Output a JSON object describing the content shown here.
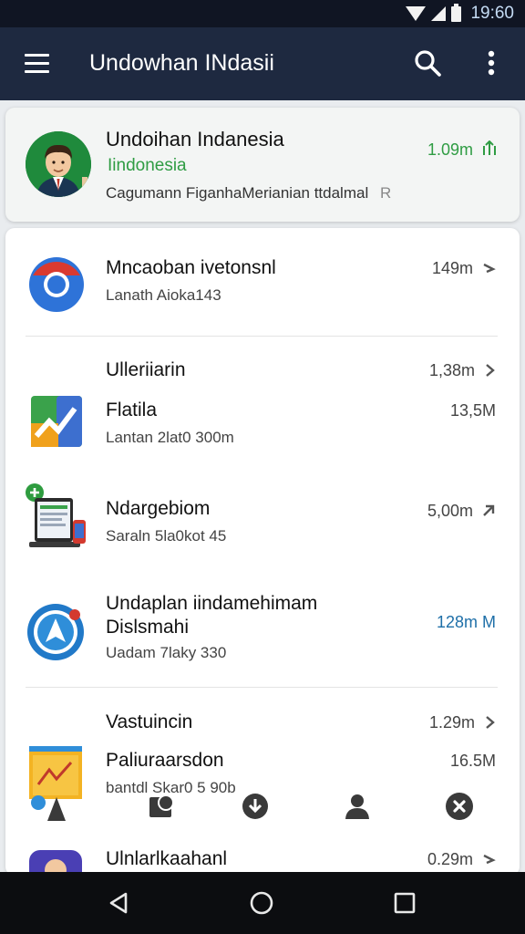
{
  "status_bar": {
    "time": "19:60"
  },
  "app_bar": {
    "title": "Undowhan INdasii"
  },
  "featured": {
    "title": "Undoihan Indanesia",
    "subtitle": "Iindonesia",
    "description": "Cagumann FiganhaMerianian ttdalmal",
    "description_tail": "R",
    "size": "1.09m"
  },
  "items": [
    {
      "title": "Mncaoban ivetonsnl",
      "subtitle": "Lanath Aioka143",
      "size": "149m"
    },
    {
      "title": "Ulleriiarin",
      "size": "1,38m"
    },
    {
      "title": "Flatila",
      "subtitle": "Lantan 2lat0 300m",
      "size": "13,5M"
    },
    {
      "title": "Ndargebiom",
      "subtitle": "Saraln 5la0kot 45",
      "size": "5,00m"
    },
    {
      "title": "Undaplan iindamehimam",
      "title2": "Dislsmahi",
      "subtitle": "Uadam 7laky 330",
      "size": "128m M"
    },
    {
      "title": "Vastuincin",
      "size": "1.29m"
    },
    {
      "title": "Paliuraarsdon",
      "subtitle": "bantdl Skar0 5 90b",
      "size": "16.5M"
    },
    {
      "title": "Ulnlarlkaahanl",
      "size": "0.29m"
    }
  ],
  "icons": {
    "menu": "menu-icon",
    "search": "search-icon",
    "more": "more-vert-icon",
    "trend_up": "trending-up-icon",
    "arrow_right": "chevron-right-icon",
    "nav_back": "back-triangle-icon",
    "nav_home": "home-circle-icon",
    "nav_recents": "recents-square-icon"
  },
  "colors": {
    "app_bar": "#1e2940",
    "status_bar": "#101523",
    "accent_green": "#2f9c43",
    "accent_blue": "#1e6fa8",
    "system_nav": "#0c0d10"
  }
}
